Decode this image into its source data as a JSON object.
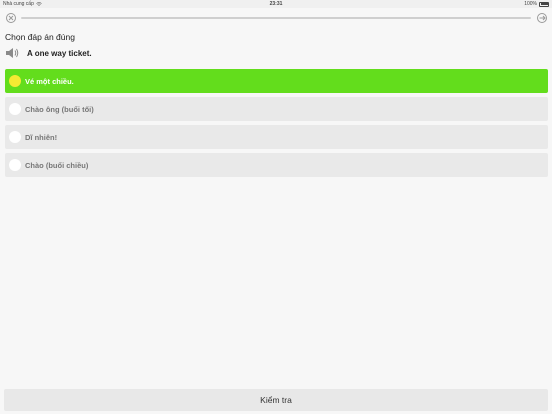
{
  "status_bar": {
    "carrier": "Nhà cung cấp",
    "time": "23:31",
    "battery": "100%"
  },
  "quiz": {
    "progress_fraction": 0.0,
    "instruction": "Chọn đáp án đúng",
    "prompt": "A one way ticket.",
    "options": [
      {
        "label": "Vé một chiều.",
        "selected": true
      },
      {
        "label": "Chào ông (buổi tối)",
        "selected": false
      },
      {
        "label": "Dĩ nhiên!",
        "selected": false
      },
      {
        "label": "Chào (buổi chiều)",
        "selected": false
      }
    ],
    "check_label": "Kiểm tra"
  },
  "colors": {
    "selected": "#63dd1c",
    "selected_radio": "#f4ea33",
    "option_bg": "#e9e9e9"
  }
}
